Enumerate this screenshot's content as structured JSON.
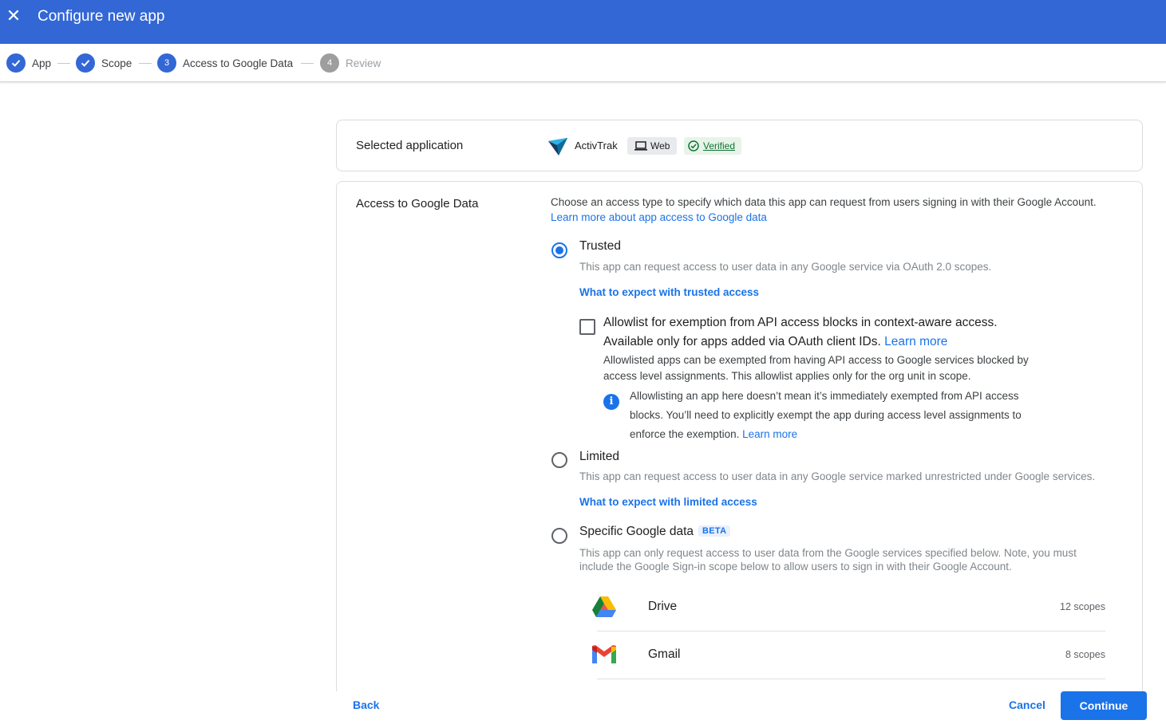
{
  "header": {
    "title": "Configure new app",
    "close_icon": "close-icon"
  },
  "stepper": {
    "steps": [
      {
        "label": "App",
        "state": "done",
        "number": "1"
      },
      {
        "label": "Scope",
        "state": "done",
        "number": "2"
      },
      {
        "label": "Access to Google Data",
        "state": "active",
        "number": "3"
      },
      {
        "label": "Review",
        "state": "pending",
        "number": "4"
      }
    ]
  },
  "selected_app": {
    "label": "Selected application",
    "app_name": "ActivTrak",
    "platform": "Web",
    "verified": "Verified"
  },
  "access": {
    "label": "Access to Google Data",
    "description": "Choose an access type to specify which data this app can request from users signing in with their Google Account.",
    "learn_more_link": "Learn more about app access to Google data",
    "options": {
      "trusted": {
        "title": "Trusted",
        "selected": true,
        "description": "This app can request access to user data in any Google service via OAuth 2.0 scopes.",
        "link": "What to expect with trusted access"
      },
      "limited": {
        "title": "Limited",
        "selected": false,
        "description": "This app can request access to user data in any Google service marked unrestricted under Google services.",
        "link": "What to expect with limited access"
      },
      "specific": {
        "title": "Specific Google data",
        "badge": "BETA",
        "selected": false,
        "description_line1": "This app can only request access to user data from the Google services specified below. Note, you must",
        "description_line2": "include the Google Sign-in scope below to allow users to sign in with their Google Account."
      }
    },
    "allowlist": {
      "checked": false,
      "title_line1": "Allowlist for exemption from API access blocks in context-aware access.",
      "title_line2": "Available only for apps added via OAuth client IDs.",
      "title_link": "Learn more",
      "body_line1": "Allowlisted apps can be exempted from having API access to Google services blocked by",
      "body_line2": "access level assignments. This allowlist applies only for the org unit in scope.",
      "info_line1": "Allowlisting an app here doesn’t mean it’s immediately exempted from API access",
      "info_line2": "blocks. You’ll need to explicitly exempt the app during access level assignments to",
      "info_line3": "enforce the exemption.",
      "info_link": "Learn more"
    },
    "services": [
      {
        "name": "Drive",
        "scopes": "12 scopes",
        "icon": "drive-icon"
      },
      {
        "name": "Gmail",
        "scopes": "8 scopes",
        "icon": "gmail-icon"
      }
    ]
  },
  "footer": {
    "back": "Back",
    "cancel": "Cancel",
    "continue": "Continue"
  },
  "colors": {
    "header": "#3367d6",
    "accent": "#1a73e8",
    "verified": "#137333"
  }
}
